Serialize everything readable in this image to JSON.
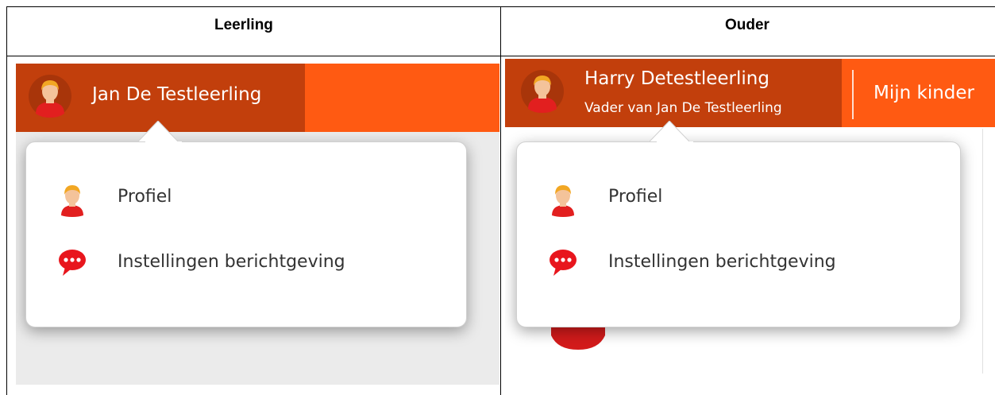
{
  "table": {
    "headers": [
      "Leerling",
      "Ouder"
    ]
  },
  "student": {
    "name": "Jan De Testleerling",
    "menu": [
      {
        "label": "Profiel",
        "icon": "user-icon"
      },
      {
        "label": "Instellingen berichtgeving",
        "icon": "speech-bubble-icon"
      }
    ]
  },
  "parent": {
    "name": "Harry Detestleerling",
    "subtitle": "Vader van Jan De Testleerling",
    "nav_label": "Mijn kinder",
    "menu": [
      {
        "label": "Profiel",
        "icon": "user-icon"
      },
      {
        "label": "Instellingen berichtgeving",
        "icon": "speech-bubble-icon"
      }
    ]
  },
  "colors": {
    "accent_orange": "#ff5a12",
    "user_box_dark": "#c23f0c",
    "icon_red": "#e8161d",
    "panel_background": "#ebebeb"
  }
}
